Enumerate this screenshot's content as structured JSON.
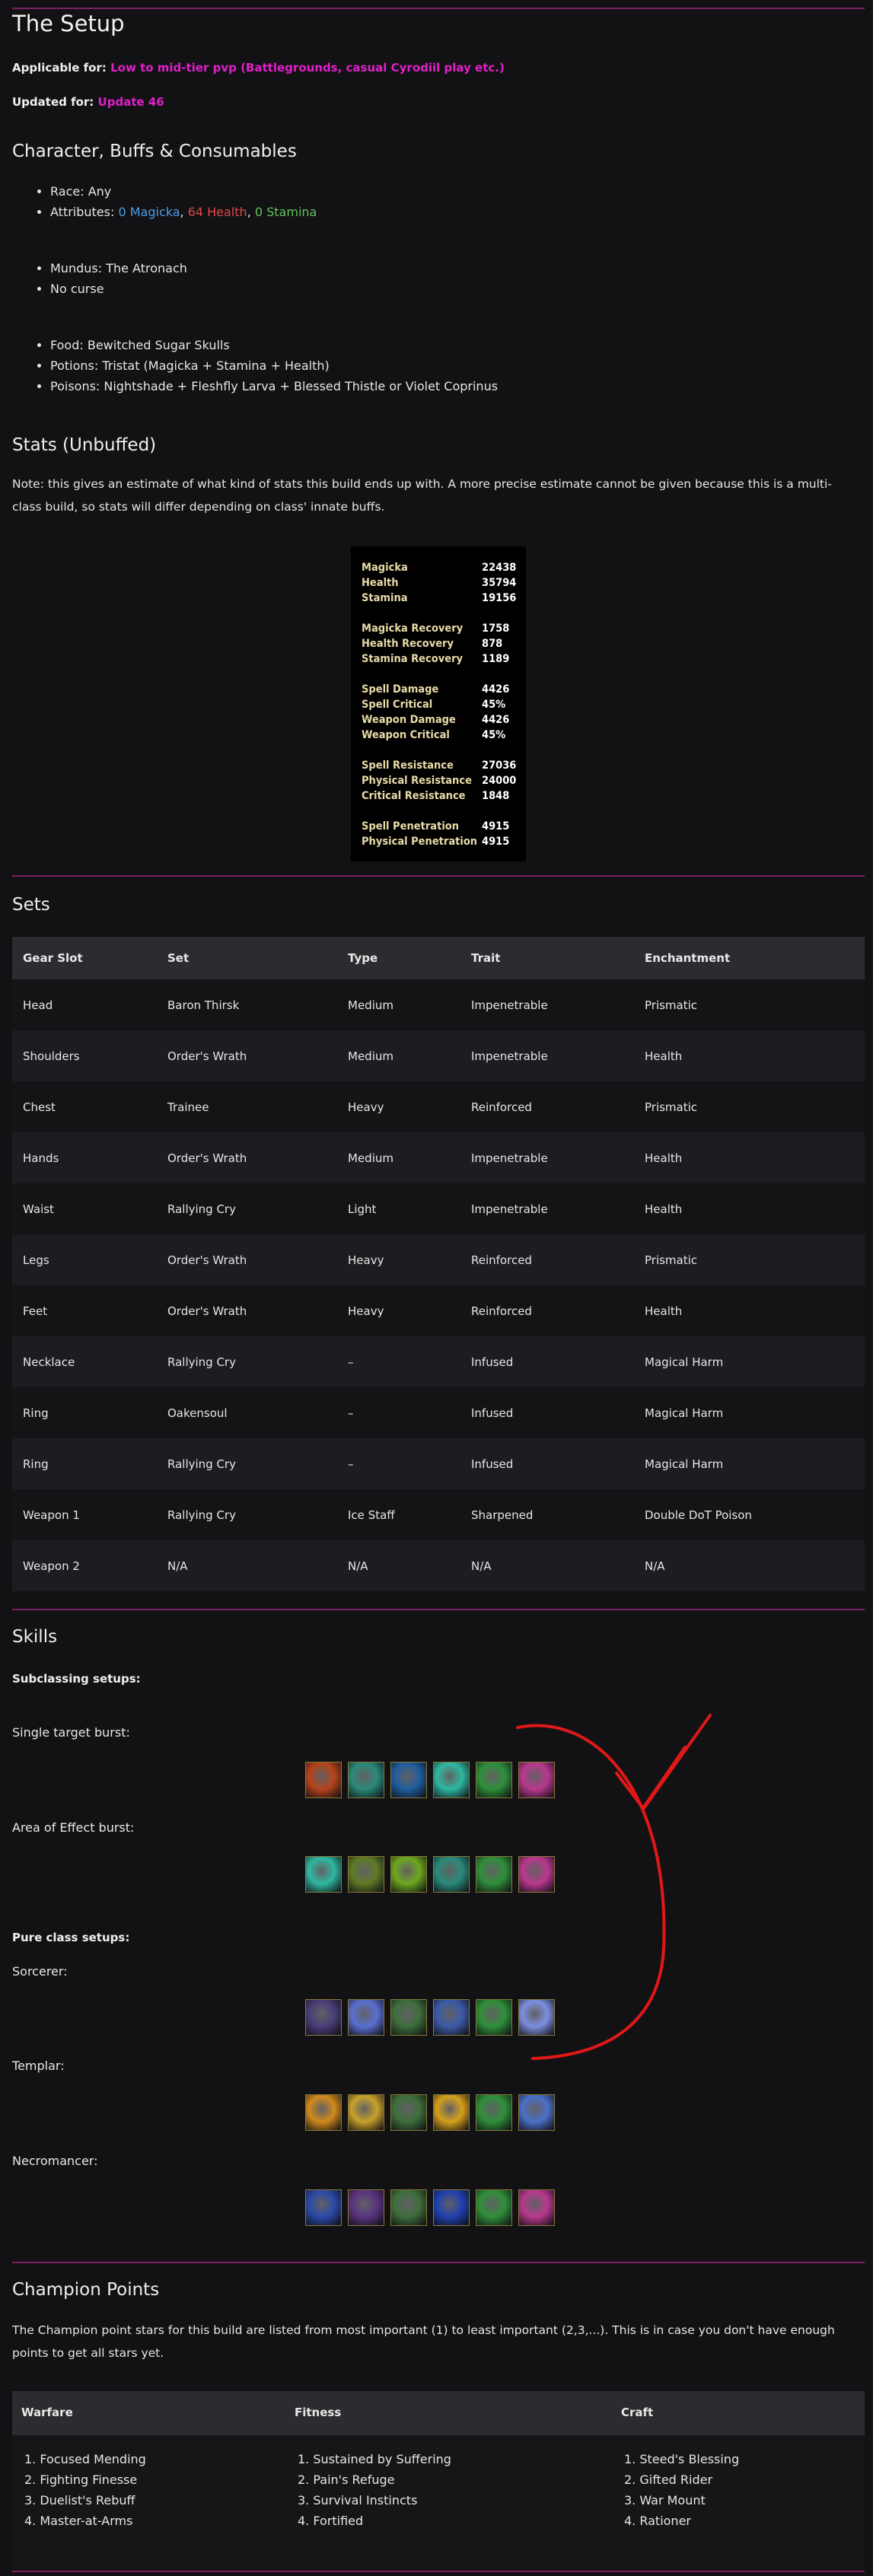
{
  "setup": {
    "title": "The Setup",
    "applicable_label": "Applicable for:",
    "applicable_value": "Low to mid-tier pvp (Battlegrounds, casual Cyrodiil play etc.)",
    "updated_label": "Updated for:",
    "updated_value": "Update 46"
  },
  "character": {
    "heading": "Character, Buffs & Consumables",
    "race": "Race: Any",
    "attr_prefix": "Attributes: ",
    "attr_mag": "0 Magicka",
    "attr_hp": "64 Health",
    "attr_st": "0 Stamina",
    "mundus": "Mundus: The Atronach",
    "curse": "No curse",
    "food": "Food: Bewitched Sugar Skulls",
    "potions": "Potions: Tristat (Magicka + Stamina + Health)",
    "poisons": "Poisons: Nightshade + Fleshfly Larva + Blessed Thistle or Violet Coprinus"
  },
  "stats": {
    "heading": "Stats (Unbuffed)",
    "note": "Note: this gives an estimate of what kind of stats this build ends up with. A more precise estimate cannot be given because this is a multi-class build, so stats will differ depending on class' innate buffs.",
    "rows": [
      {
        "label": "Magicka",
        "value": "22438"
      },
      {
        "label": "Health",
        "value": "35794"
      },
      {
        "label": "Stamina",
        "value": "19156"
      },
      {
        "label": "Magicka Recovery",
        "value": "1758"
      },
      {
        "label": "Health Recovery",
        "value": "878"
      },
      {
        "label": "Stamina Recovery",
        "value": "1189"
      },
      {
        "label": "Spell Damage",
        "value": "4426"
      },
      {
        "label": "Spell Critical",
        "value": "45%"
      },
      {
        "label": "Weapon Damage",
        "value": "4426"
      },
      {
        "label": "Weapon Critical",
        "value": "45%"
      },
      {
        "label": "Spell Resistance",
        "value": "27036"
      },
      {
        "label": "Physical Resistance",
        "value": "24000"
      },
      {
        "label": "Critical Resistance",
        "value": "1848"
      },
      {
        "label": "Spell Penetration",
        "value": "4915"
      },
      {
        "label": "Physical Penetration",
        "value": "4915"
      }
    ]
  },
  "sets": {
    "heading": "Sets",
    "columns": [
      "Gear Slot",
      "Set",
      "Type",
      "Trait",
      "Enchantment"
    ],
    "rows": [
      [
        "Head",
        "Baron Thirsk",
        "Medium",
        "Impenetrable",
        "Prismatic"
      ],
      [
        "Shoulders",
        "Order's Wrath",
        "Medium",
        "Impenetrable",
        "Health"
      ],
      [
        "Chest",
        "Trainee",
        "Heavy",
        "Reinforced",
        "Prismatic"
      ],
      [
        "Hands",
        "Order's Wrath",
        "Medium",
        "Impenetrable",
        "Health"
      ],
      [
        "Waist",
        "Rallying Cry",
        "Light",
        "Impenetrable",
        "Health"
      ],
      [
        "Legs",
        "Order's Wrath",
        "Heavy",
        "Reinforced",
        "Prismatic"
      ],
      [
        "Feet",
        "Order's Wrath",
        "Heavy",
        "Reinforced",
        "Health"
      ],
      [
        "Necklace",
        "Rallying Cry",
        "–",
        "Infused",
        "Magical Harm"
      ],
      [
        "Ring",
        "Oakensoul",
        "–",
        "Infused",
        "Magical Harm"
      ],
      [
        "Ring",
        "Rallying Cry",
        "–",
        "Infused",
        "Magical Harm"
      ],
      [
        "Weapon 1",
        "Rallying Cry",
        "Ice Staff",
        "Sharpened",
        "Double DoT Poison"
      ],
      [
        "Weapon 2",
        "N/A",
        "N/A",
        "N/A",
        "N/A"
      ]
    ]
  },
  "skills": {
    "heading": "Skills",
    "subclass_heading": "Subclassing setups:",
    "single_target": "Single target burst:",
    "aoe": "Area of Effect burst:",
    "pure_heading": "Pure class setups:",
    "sorcerer": "Sorcerer:",
    "templar": "Templar:",
    "necromancer": "Necromancer:",
    "bars": {
      "single_target": [
        "fire-claw-skill-icon",
        "teal-beast-skill-icon",
        "blue-orb-skill-icon",
        "teal-wave-skill-icon",
        "green-figure-skill-icon",
        "pink-burst-skill-icon"
      ],
      "aoe": [
        "teal-wave-skill-icon",
        "olive-beast-skill-icon",
        "green-ring-skill-icon",
        "teal-beast-skill-icon",
        "green-figure-skill-icon",
        "pink-burst-skill-icon"
      ],
      "sorcerer": [
        "purple-reaper-skill-icon",
        "lightning-skill-icon",
        "spear-skill-icon",
        "blue-rune-skill-icon",
        "green-figure-skill-icon",
        "white-flash-skill-icon"
      ],
      "templar": [
        "sun-flare-skill-icon",
        "golden-spear-skill-icon",
        "spear-skill-icon",
        "golden-figure-skill-icon",
        "green-figure-skill-icon",
        "blue-spark-skill-icon"
      ],
      "necromancer": [
        "blue-skeleton-skill-icon",
        "purple-beast-skill-icon",
        "spear-skill-icon",
        "blue-flame-skill-icon",
        "green-figure-skill-icon",
        "pink-burst-skill-icon"
      ]
    },
    "colors": {
      "fire-claw-skill-icon": "#b5431c",
      "teal-beast-skill-icon": "#2a8a7a",
      "blue-orb-skill-icon": "#1f5d9e",
      "teal-wave-skill-icon": "#2fb8a2",
      "green-figure-skill-icon": "#2e8f3a",
      "pink-burst-skill-icon": "#b8388e",
      "olive-beast-skill-icon": "#5f7a26",
      "green-ring-skill-icon": "#6ea81f",
      "purple-reaper-skill-icon": "#4a3d78",
      "lightning-skill-icon": "#5a6fd0",
      "spear-skill-icon": "#3d6e3d",
      "blue-rune-skill-icon": "#3c5aa8",
      "white-flash-skill-icon": "#7d8fe0",
      "sun-flare-skill-icon": "#d08a1c",
      "golden-spear-skill-icon": "#c9a12a",
      "golden-figure-skill-icon": "#d6a01d",
      "blue-spark-skill-icon": "#4a70c8",
      "blue-skeleton-skill-icon": "#2b49a8",
      "purple-beast-skill-icon": "#5a3380",
      "blue-flame-skill-icon": "#2140b0"
    }
  },
  "champion": {
    "heading": "Champion Points",
    "note": "The Champion point stars for this build are listed from most important (1) to least important (2,3,...). This is in case you don't have enough points to get all stars yet.",
    "columns": [
      "Warfare",
      "Fitness",
      "Craft"
    ],
    "warfare": [
      "1. Focused Mending",
      "2. Fighting Finesse",
      "3. Duelist's Rebuff",
      "4. Master-at-Arms"
    ],
    "fitness": [
      "1. Sustained by Suffering",
      "2. Pain's Refuge",
      "3. Survival Instincts",
      "4. Fortified"
    ],
    "craft": [
      "1. Steed's Blessing",
      "2. Gifted Rider",
      "3. War Mount",
      "4. Rationer"
    ]
  },
  "colors": {
    "accent": "#e020c8",
    "divider": "#7b1f63",
    "magicka": "#4b9be8",
    "health": "#e04848",
    "stamina": "#5ec45e",
    "annotation": "#e01818"
  }
}
